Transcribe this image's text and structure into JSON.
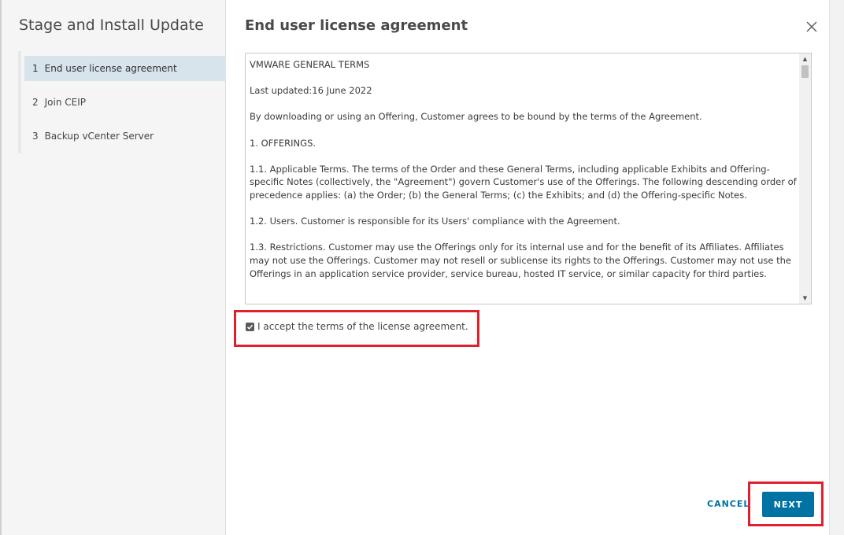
{
  "wizard": {
    "title": "Stage and Install Update",
    "steps": [
      {
        "number": "1",
        "label": "End user license agreement",
        "active": true
      },
      {
        "number": "2",
        "label": "Join CEIP",
        "active": false
      },
      {
        "number": "3",
        "label": "Backup vCenter Server",
        "active": false
      }
    ]
  },
  "main": {
    "title": "End user license agreement",
    "close_icon": "close-icon",
    "eula_paragraphs": [
      "VMWARE GENERAL TERMS",
      "Last updated:16 June 2022",
      "By downloading or using an Offering, Customer agrees to be bound by the terms of the Agreement.",
      "1. OFFERINGS.",
      "1.1. Applicable Terms. The terms of the Order and these General Terms, including applicable Exhibits and Offering-specific Notes (collectively, the \"Agreement\") govern Customer's use of the Offerings. The following descending order of precedence applies: (a) the Order; (b) the General Terms; (c) the Exhibits; and (d) the Offering-specific Notes.",
      "1.2. Users. Customer is responsible for its Users' compliance with the Agreement.",
      "1.3. Restrictions. Customer may use the Offerings only for its internal use and for the benefit of its Affiliates. Affiliates may not use the Offerings. Customer may not resell or sublicense its rights to the Offerings. Customer may not use the Offerings in an application service provider, service bureau, hosted IT service, or similar capacity for third parties."
    ],
    "accept_label": "I accept the terms of the license agreement.",
    "accept_checked": true
  },
  "footer": {
    "cancel_label": "CANCEL",
    "next_label": "NEXT"
  },
  "colors": {
    "primary": "#0072a3",
    "highlight": "#e0202d",
    "active_step": "#d8e4ec"
  }
}
